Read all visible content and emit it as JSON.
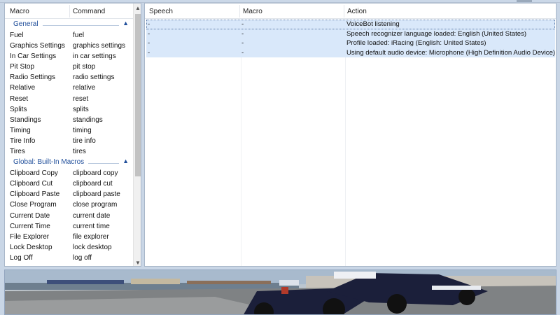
{
  "left_pane": {
    "headers": {
      "macro": "Macro",
      "command": "Command"
    },
    "groups": [
      {
        "title": "General",
        "items": [
          {
            "macro": "Fuel",
            "command": "fuel"
          },
          {
            "macro": "Graphics Settings",
            "command": "graphics settings"
          },
          {
            "macro": "In Car Settings",
            "command": "in car settings"
          },
          {
            "macro": "Pit Stop",
            "command": "pit stop"
          },
          {
            "macro": "Radio Settings",
            "command": "radio settings"
          },
          {
            "macro": "Relative",
            "command": "relative"
          },
          {
            "macro": "Reset",
            "command": "reset"
          },
          {
            "macro": "Splits",
            "command": "splits"
          },
          {
            "macro": "Standings",
            "command": "standings"
          },
          {
            "macro": "Timing",
            "command": "timing"
          },
          {
            "macro": "Tire Info",
            "command": "tire info"
          },
          {
            "macro": "Tires",
            "command": "tires"
          }
        ]
      },
      {
        "title": "Global: Built-In Macros",
        "items": [
          {
            "macro": "Clipboard Copy",
            "command": "clipboard copy"
          },
          {
            "macro": "Clipboard Cut",
            "command": "clipboard cut"
          },
          {
            "macro": "Clipboard Paste",
            "command": "clipboard paste"
          },
          {
            "macro": "Close Program",
            "command": "close program"
          },
          {
            "macro": "Current Date",
            "command": "current date"
          },
          {
            "macro": "Current Time",
            "command": "current time"
          },
          {
            "macro": "File Explorer",
            "command": "file explorer"
          },
          {
            "macro": "Lock Desktop",
            "command": "lock desktop"
          },
          {
            "macro": "Log Off",
            "command": "log off"
          }
        ]
      }
    ],
    "collapse_icon": "chevron-up-icon",
    "scroll_up_icon": "scroll-up-arrow-icon",
    "scroll_down_icon": "scroll-down-arrow-icon"
  },
  "log": {
    "headers": {
      "speech": "Speech",
      "macro": "Macro",
      "action": "Action"
    },
    "rows": [
      {
        "speech": "-",
        "macro": "-",
        "action": "VoiceBot listening"
      },
      {
        "speech": "-",
        "macro": "-",
        "action": "Speech recognizer language loaded: English (United States)"
      },
      {
        "speech": "-",
        "macro": "-",
        "action": "Profile loaded: iRacing (English: United States)"
      },
      {
        "speech": "-",
        "macro": "-",
        "action": "Using default audio device: Microphone (High Definition Audio Device)"
      }
    ]
  },
  "banner": {
    "image": "race-car-banner-image"
  },
  "colors": {
    "group_header": "#1f4e9a",
    "log_row_bg": "#d9e8fa",
    "pane_border": "#a9b7c9",
    "frame_bg": "#c9d6e6"
  }
}
